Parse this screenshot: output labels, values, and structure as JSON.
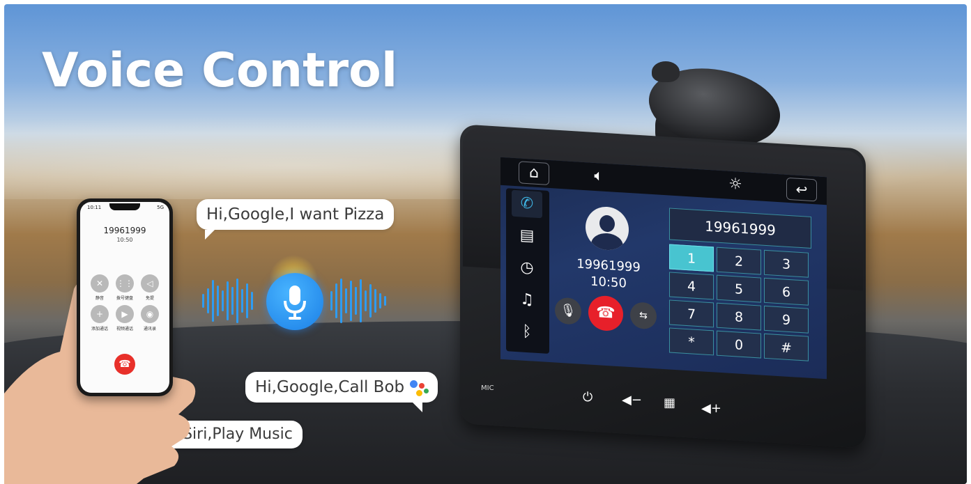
{
  "headline": "Voice Control",
  "bubbles": {
    "pizza": "Hi,Google,I want Pizza",
    "call_bob": "Hi,Google,Call Bob",
    "siri_music": "Hey Siri,Play Music"
  },
  "colors": {
    "accent_blue": "#2e9cf2",
    "end_call_red": "#e7202a",
    "keypad_highlight": "#48c4d0"
  },
  "phone": {
    "status_time": "10:11",
    "status_signal": "5G",
    "number": "19961999",
    "time": "10:50",
    "buttons": [
      {
        "icon": "mute-icon",
        "label": "静音"
      },
      {
        "icon": "keypad-icon",
        "label": "拨号键盘"
      },
      {
        "icon": "speaker-icon",
        "label": "免提"
      },
      {
        "icon": "add-call-icon",
        "label": "添加通话"
      },
      {
        "icon": "video-call-icon",
        "label": "视频通话"
      },
      {
        "icon": "contacts-icon",
        "label": "通讯录"
      }
    ]
  },
  "display": {
    "caller_number": "19961999",
    "caller_time": "10:50",
    "keypad_display": "19961999",
    "keys": [
      "1",
      "2",
      "3",
      "4",
      "5",
      "6",
      "7",
      "8",
      "9",
      "*",
      "0",
      "#"
    ],
    "active_key": "1",
    "mic_label": "MIC",
    "sidebar_icons": [
      "phone-icon",
      "contacts-book-icon",
      "call-history-icon",
      "music-icon",
      "bluetooth-icon"
    ]
  }
}
